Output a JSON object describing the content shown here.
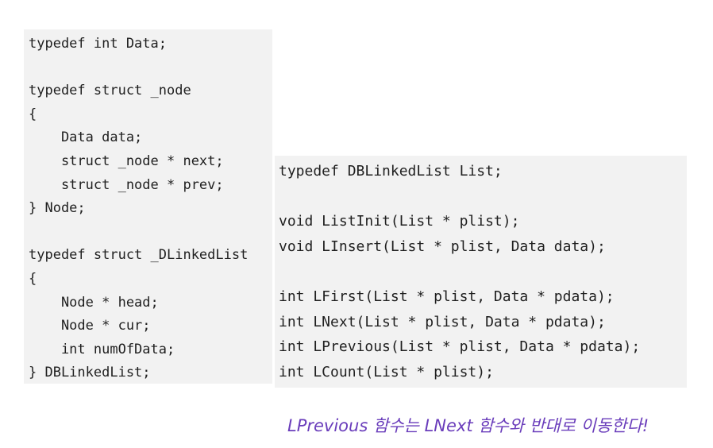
{
  "left_code": {
    "lines": [
      "typedef int Data;",
      "",
      "typedef struct _node",
      "{",
      "    Data data;",
      "    struct _node * next;",
      "    struct _node * prev;",
      "} Node;",
      "",
      "typedef struct _DLinkedList",
      "{",
      "    Node * head;",
      "    Node * cur;",
      "    int numOfData;",
      "} DBLinkedList;"
    ]
  },
  "right_code": {
    "lines": [
      "typedef DBLinkedList List;",
      "",
      "void ListInit(List * plist);",
      "void LInsert(List * plist, Data data);",
      "",
      "int LFirst(List * plist, Data * pdata);",
      "int LNext(List * plist, Data * pdata);",
      "int LPrevious(List * plist, Data * pdata);",
      "int LCount(List * plist);"
    ]
  },
  "annotation": {
    "text": "LPrevious 함수는 LNext 함수와 반대로 이동한다!",
    "color": "#6a3dbb"
  }
}
